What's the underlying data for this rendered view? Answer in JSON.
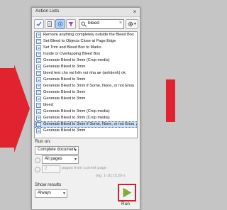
{
  "window": {
    "title": "Action Lists",
    "close_glyph": "×"
  },
  "toolbar": {
    "buttons": [
      {
        "icon": "checkmark-icon"
      },
      {
        "icon": "document-icon"
      },
      {
        "icon": "circle-filter-icon",
        "active": true
      },
      {
        "icon": "funnel-icon"
      }
    ],
    "search_value": "bleed",
    "search_clear": "×",
    "settings_icon": "gear-icon"
  },
  "actions": [
    "Remove anything completely outside the Bleed Box",
    "Set Bleed to Objects Close at Page Edge",
    "Set Trim and Bleed Box to Marks",
    "Inside or Overlapping Bleed Box",
    "Generate Bleed to 3mm (Crop media)",
    "Generate Bleed to 3mm",
    "bleed test cho vui hên vui nha ae (anhtienh) ok",
    "Generate Bleed to 3mm",
    "Generate Bleed to 3mm if Some, None, or not Enou",
    "Generate Bleed to 3mm",
    "Generate Bleed to 3mm",
    "bleed",
    "Generate Bleed to 3mm (Crop media)",
    "Generate Bleed to 3mm (Crop media)",
    "Generate Bleed to 3mm if Some, None, or not Enou",
    "Generate Bleed to 3mm"
  ],
  "selected_index": 14,
  "run_on": {
    "label": "Run on:",
    "document_value": "Complete document",
    "pages_value": "All pages",
    "page_count": "2",
    "pages_from_current": "pages from current page",
    "example": "(eg: 1-10,15,20-)"
  },
  "show_results": {
    "label": "Show results",
    "value": "Always"
  },
  "run_button": {
    "label": "Run",
    "icon": "play-icon",
    "color": "#7bb32e"
  },
  "colors": {
    "highlight": "#d0202a",
    "background_red": "#e0232e"
  }
}
